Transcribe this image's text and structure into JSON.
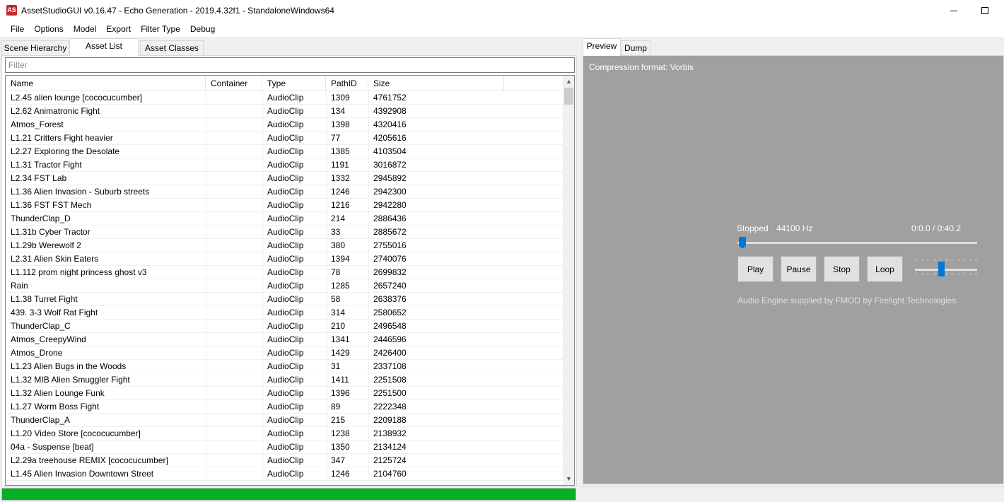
{
  "window": {
    "title": "AssetStudioGUI v0.16.47 - Echo Generation - 2019.4.32f1 - StandaloneWindows64",
    "icon_label": "AS"
  },
  "menu": [
    "File",
    "Options",
    "Model",
    "Export",
    "Filter Type",
    "Debug"
  ],
  "left_tabs": [
    "Scene Hierarchy",
    "Asset List",
    "Asset Classes"
  ],
  "left_active_tab": "Asset List",
  "filter": {
    "placeholder": "Filter",
    "value": ""
  },
  "columns": [
    "Name",
    "Container",
    "Type",
    "PathID",
    "Size"
  ],
  "rows": [
    [
      "L2.45 alien lounge [cococucumber]",
      "",
      "AudioClip",
      "1309",
      "4761752"
    ],
    [
      "L2.62 Animatronic Fight",
      "",
      "AudioClip",
      "134",
      "4392908"
    ],
    [
      "Atmos_Forest",
      "",
      "AudioClip",
      "1398",
      "4320416"
    ],
    [
      "L1.21 Critters Fight heavier",
      "",
      "AudioClip",
      "77",
      "4205616"
    ],
    [
      "L2.27 Exploring the Desolate",
      "",
      "AudioClip",
      "1385",
      "4103504"
    ],
    [
      "L1.31 Tractor Fight",
      "",
      "AudioClip",
      "1191",
      "3016872"
    ],
    [
      "L2.34 FST Lab",
      "",
      "AudioClip",
      "1332",
      "2945892"
    ],
    [
      "L1.36 Alien Invasion - Suburb streets",
      "",
      "AudioClip",
      "1246",
      "2942300"
    ],
    [
      "L1.36 FST FST Mech",
      "",
      "AudioClip",
      "1216",
      "2942280"
    ],
    [
      "ThunderClap_D",
      "",
      "AudioClip",
      "214",
      "2886436"
    ],
    [
      "L1.31b Cyber Tractor",
      "",
      "AudioClip",
      "33",
      "2885672"
    ],
    [
      "L1.29b Werewolf 2",
      "",
      "AudioClip",
      "380",
      "2755016"
    ],
    [
      "L2.31 Alien Skin Eaters",
      "",
      "AudioClip",
      "1394",
      "2740076"
    ],
    [
      "L1.112 prom night princess ghost v3",
      "",
      "AudioClip",
      "78",
      "2699832"
    ],
    [
      "Rain",
      "",
      "AudioClip",
      "1285",
      "2657240"
    ],
    [
      "L1.38 Turret Fight",
      "",
      "AudioClip",
      "58",
      "2638376"
    ],
    [
      "439. 3-3 Wolf Rat Fight",
      "",
      "AudioClip",
      "314",
      "2580652"
    ],
    [
      "ThunderClap_C",
      "",
      "AudioClip",
      "210",
      "2496548"
    ],
    [
      "Atmos_CreepyWind",
      "",
      "AudioClip",
      "1341",
      "2446596"
    ],
    [
      "Atmos_Drone",
      "",
      "AudioClip",
      "1429",
      "2426400"
    ],
    [
      "L1.23 Alien Bugs in the Woods",
      "",
      "AudioClip",
      "31",
      "2337108"
    ],
    [
      "L1.32 MIB Alien Smuggler Fight",
      "",
      "AudioClip",
      "1411",
      "2251508"
    ],
    [
      "L1.32 Alien Lounge Funk",
      "",
      "AudioClip",
      "1396",
      "2251500"
    ],
    [
      "L1.27 Worm Boss Fight",
      "",
      "AudioClip",
      "89",
      "2222348"
    ],
    [
      "ThunderClap_A",
      "",
      "AudioClip",
      "215",
      "2209188"
    ],
    [
      "L1.20 Video Store [cococucumber]",
      "",
      "AudioClip",
      "1238",
      "2138932"
    ],
    [
      "04a - Suspense [beat]",
      "",
      "AudioClip",
      "1350",
      "2134124"
    ],
    [
      "L2.29a treehouse REMIX [cococucumber]",
      "",
      "AudioClip",
      "347",
      "2125724"
    ],
    [
      "L1.45 Alien Invasion Downtown Street",
      "",
      "AudioClip",
      "1246",
      "2104760"
    ]
  ],
  "progress": {
    "fraction": 1.0,
    "color": "#06b025"
  },
  "right_tabs": [
    "Preview",
    "Dump"
  ],
  "right_active_tab": "Preview",
  "preview": {
    "compression": "Compression format: Vorbis",
    "status": "Stopped",
    "sample_rate": "44100 Hz",
    "time": "0:0.0 / 0:40.2",
    "seek_fraction": 0.0,
    "volume_fraction": 0.42,
    "buttons": [
      "Play",
      "Pause",
      "Stop",
      "Loop"
    ],
    "credit": "Audio Engine supplied by FMOD by Firelight Technologies."
  },
  "colors": {
    "accent": "#0078d7",
    "preview_bg": "#a0a0a0",
    "app_icon": "#c62828"
  }
}
